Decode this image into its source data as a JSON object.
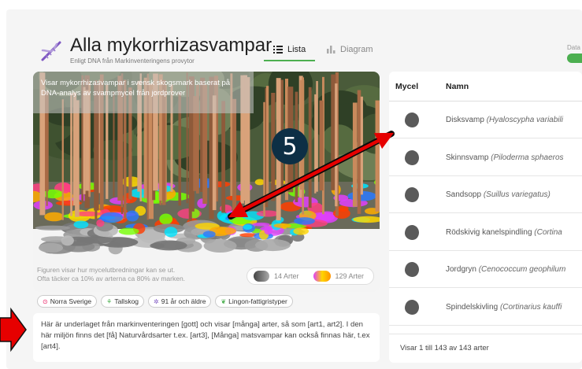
{
  "header": {
    "title": "Alla mykorrhizasvampar",
    "subtitle": "Enligt DNA från Markinventeringens provytor",
    "tabs": [
      {
        "label": "Lista",
        "icon": "list-icon",
        "active": true
      },
      {
        "label": "Diagram",
        "icon": "bar-chart-icon",
        "active": false
      }
    ],
    "data_label": "Data",
    "accent": "#4caf50"
  },
  "forest": {
    "description": "Visar mykorrhizasvampar i svensk skogsmark baserat på DNA-analys av svampmycel från jordprover",
    "caption_line1": "Figuren visar hur mycelutbredningar kan se ut.",
    "caption_line2": "Ofta täcker ca 10% av arterna ca 80% av marken.",
    "legend": [
      {
        "label": "14 Arter",
        "icon": "gray-blob-icon"
      },
      {
        "label": "129 Arter",
        "icon": "colored-blob-icon"
      }
    ]
  },
  "chips": [
    {
      "label": "Norra Sverige",
      "icon": "location-pin-icon",
      "color": "#e91e63"
    },
    {
      "label": "Tallskog",
      "icon": "tree-icon",
      "color": "#4caf50"
    },
    {
      "label": "91 år och äldre",
      "icon": "age-icon",
      "color": "#7e57c2"
    },
    {
      "label": "Lingon-fattigristyper",
      "icon": "leaf-icon",
      "color": "#4caf50"
    }
  ],
  "description": "Här är underlaget från markinventeringen [gott] och visar [många] arter, så som [art1, art2]. I den här miljön finns det [få] Naturvårdsarter t.ex. [art3], [Många] matsvampar kan också finnas här, t.ex [art4].",
  "list": {
    "col_mycel": "Mycel",
    "col_name": "Namn",
    "rows": [
      {
        "name": "Disksvamp",
        "latin": "(Hyaloscypha variabili"
      },
      {
        "name": "Skinnsvamp",
        "latin": "(Piloderma sphaeros"
      },
      {
        "name": "Sandsopp",
        "latin": "(Suillus variegatus)"
      },
      {
        "name": "Rödskivig kanelspindling",
        "latin": "(Cortina"
      },
      {
        "name": "Jordgryn",
        "latin": "(Cenococcum geophilum"
      },
      {
        "name": "Spindelskivling",
        "latin": "(Cortinarius kauffi"
      }
    ],
    "footer": "Visar 1 till 143 av 143 arter"
  },
  "annotation": {
    "badge": "5",
    "arrow_color": "#e60000"
  }
}
